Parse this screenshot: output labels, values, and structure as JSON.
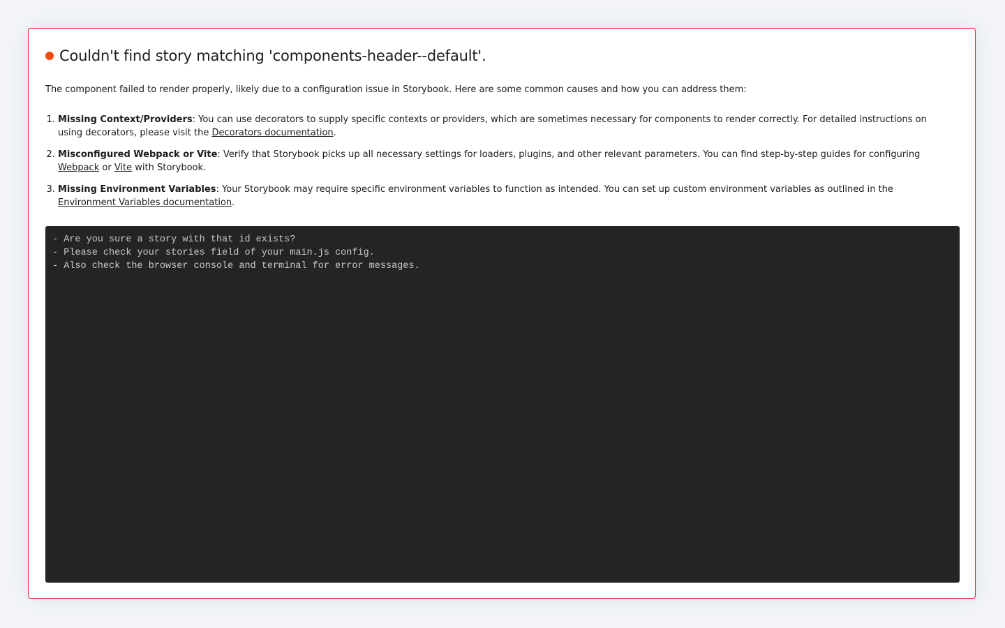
{
  "error": {
    "title": "Couldn't find story matching 'components-header--default'.",
    "intro": "The component failed to render properly, likely due to a configuration issue in Storybook. Here are some common causes and how you can address them:",
    "causes": [
      {
        "title": "Missing Context/Providers",
        "text_before": ": You can use decorators to supply specific contexts or providers, which are sometimes necessary for components to render correctly. For detailed instructions on using decorators, please visit the ",
        "link": "Decorators documentation",
        "text_after": "."
      },
      {
        "title": "Misconfigured Webpack or Vite",
        "text_before": ": Verify that Storybook picks up all necessary settings for loaders, plugins, and other relevant parameters. You can find step-by-step guides for configuring ",
        "link_1": "Webpack",
        "text_between": " or ",
        "link_2": "Vite",
        "text_after": " with Storybook."
      },
      {
        "title": "Missing Environment Variables",
        "text_before": ": Your Storybook may require specific environment variables to function as intended. You can set up custom environment variables as outlined in the ",
        "link": "Environment Variables documentation",
        "text_after": "."
      }
    ],
    "console_lines": [
      "- Are you sure a story with that id exists?",
      "- Please check your stories field of your main.js config.",
      "- Also check the browser console and terminal for error messages."
    ]
  },
  "colors": {
    "accent_dot": "#f24b12",
    "panel_border": "#d8243a",
    "console_background": "#242424",
    "page_background": "#f3f5f8"
  },
  "icons": {
    "status": "error-dot-icon"
  }
}
